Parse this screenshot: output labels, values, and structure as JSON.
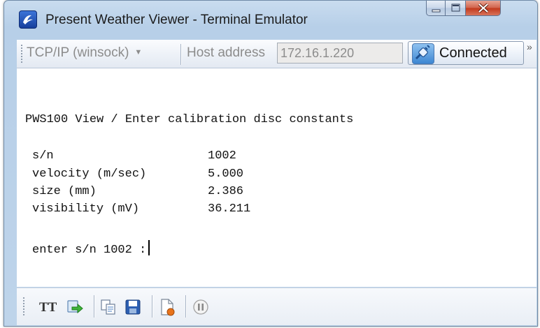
{
  "window": {
    "title": "Present Weather Viewer - Terminal Emulator",
    "controls": {
      "close_label": "X"
    }
  },
  "toolbar": {
    "connection_type": "TCP/IP (winsock)",
    "host_label": "Host address",
    "host_value": "172.16.1.220",
    "connect_button_label": "Connected",
    "overflow_label": "»"
  },
  "terminal": {
    "header": "PWS100 View / Enter calibration disc constants",
    "fields": [
      {
        "label": "s/n",
        "value": "1002"
      },
      {
        "label": "velocity (m/sec)",
        "value": "5.000"
      },
      {
        "label": "size (mm)",
        "value": "2.386"
      },
      {
        "label": "visibility (mV)",
        "value": "36.211"
      }
    ],
    "prompt": "enter s/n 1002 :"
  },
  "bottom_toolbar": {
    "font_button_label": "TT",
    "icons": [
      "send-icon",
      "copy-icon",
      "save-icon",
      "log-file-icon",
      "pause-icon"
    ]
  },
  "colors": {
    "close_button": "#c2391d",
    "titlebar": "#c9dcef",
    "toolbar": "#eef2f8"
  }
}
